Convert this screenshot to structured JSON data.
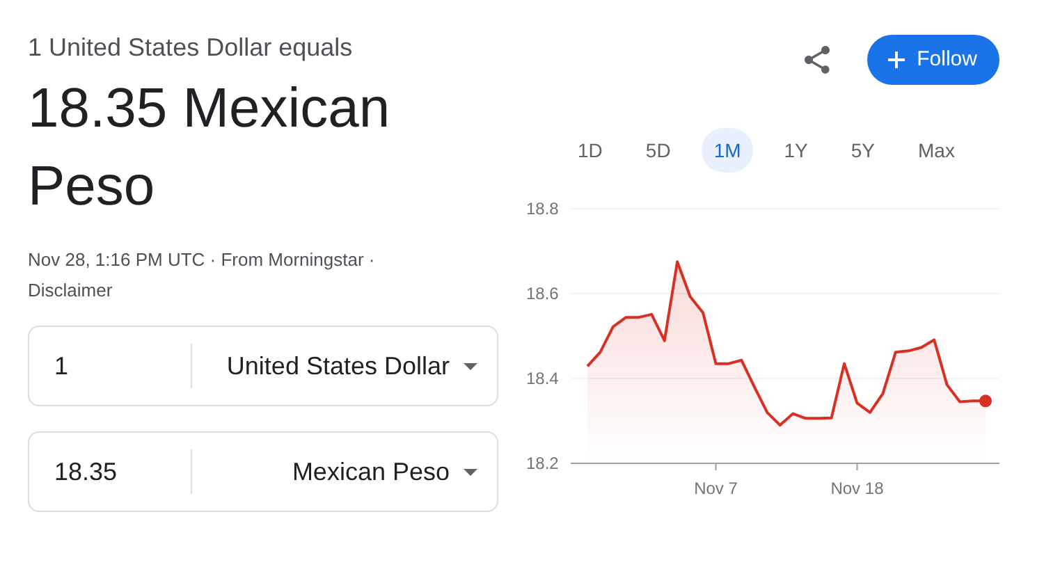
{
  "header": {
    "equals_text": "1 United States Dollar equals",
    "result": "18.35 Mexican Peso",
    "source": "Nov 28, 1:16 PM UTC · From Morningstar · Disclaimer"
  },
  "follow_button": {
    "label": "Follow"
  },
  "converter": [
    {
      "amount": "1",
      "currency": "United States Dollar"
    },
    {
      "amount": "18.35",
      "currency": "Mexican Peso"
    }
  ],
  "ranges": [
    {
      "label": "1D",
      "selected": false
    },
    {
      "label": "5D",
      "selected": false
    },
    {
      "label": "1M",
      "selected": true
    },
    {
      "label": "1Y",
      "selected": false
    },
    {
      "label": "5Y",
      "selected": false
    },
    {
      "label": "Max",
      "selected": false
    }
  ],
  "chart_data": {
    "type": "area",
    "categories": [
      null,
      null,
      null,
      null,
      null,
      null,
      null,
      null,
      null,
      null,
      "Nov 7",
      null,
      null,
      null,
      null,
      null,
      null,
      null,
      null,
      null,
      null,
      "Nov 18",
      null,
      null,
      null,
      null,
      null,
      null,
      null,
      null,
      null,
      null
    ],
    "series": [
      {
        "color": "#d93025",
        "values": [
          18.429,
          18.462,
          18.522,
          18.544,
          18.544,
          18.551,
          18.489,
          18.675,
          18.593,
          18.555,
          18.435,
          18.435,
          18.443,
          18.38,
          18.32,
          18.29,
          18.317,
          18.306,
          18.306,
          18.307,
          18.435,
          18.342,
          18.32,
          18.364,
          18.462,
          18.465,
          18.473,
          18.491,
          18.385,
          18.345,
          18.347,
          18.347
        ]
      }
    ],
    "ylim": [
      18.2,
      18.8
    ],
    "yticks": [
      18.2,
      18.4,
      18.6,
      18.8
    ]
  }
}
